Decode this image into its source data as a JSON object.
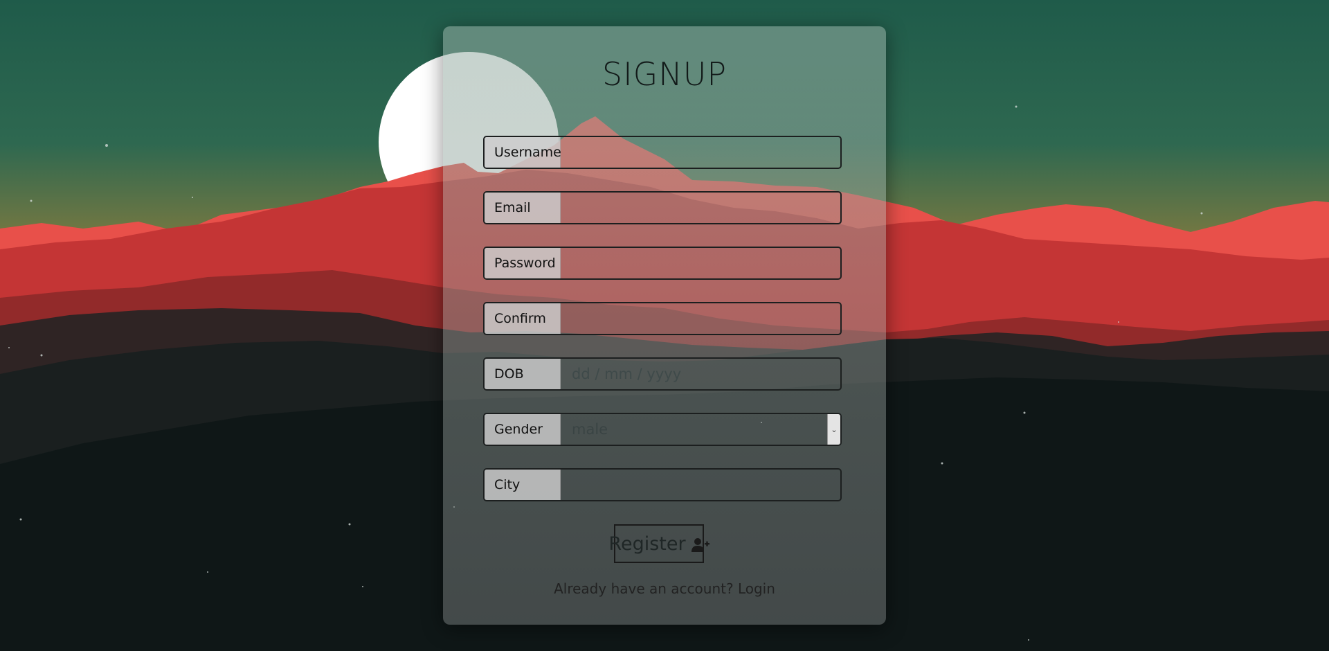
{
  "form": {
    "title": "SIGNUP",
    "fields": [
      {
        "label": "Username",
        "value": "",
        "placeholder": ""
      },
      {
        "label": "Email",
        "value": "",
        "placeholder": ""
      },
      {
        "label": "Password",
        "value": "",
        "placeholder": ""
      },
      {
        "label": "Confirm",
        "value": "",
        "placeholder": ""
      },
      {
        "label": "DOB",
        "value": "",
        "placeholder": "dd / mm / yyyy"
      },
      {
        "label": "Gender",
        "selected": "male"
      },
      {
        "label": "City",
        "value": "",
        "placeholder": ""
      }
    ],
    "register_label": "Register",
    "login_prompt": "Already have an account?",
    "login_link": "Login"
  },
  "colors": {
    "sky_top": "#1f5c4a",
    "sky_bottom": "#7a7a3e",
    "mountain_red": "#d83f3f",
    "mountain_dark": "#101a1a"
  },
  "icons": {
    "register": "user-plus-icon",
    "dropdown": "chevron-down-icon"
  }
}
